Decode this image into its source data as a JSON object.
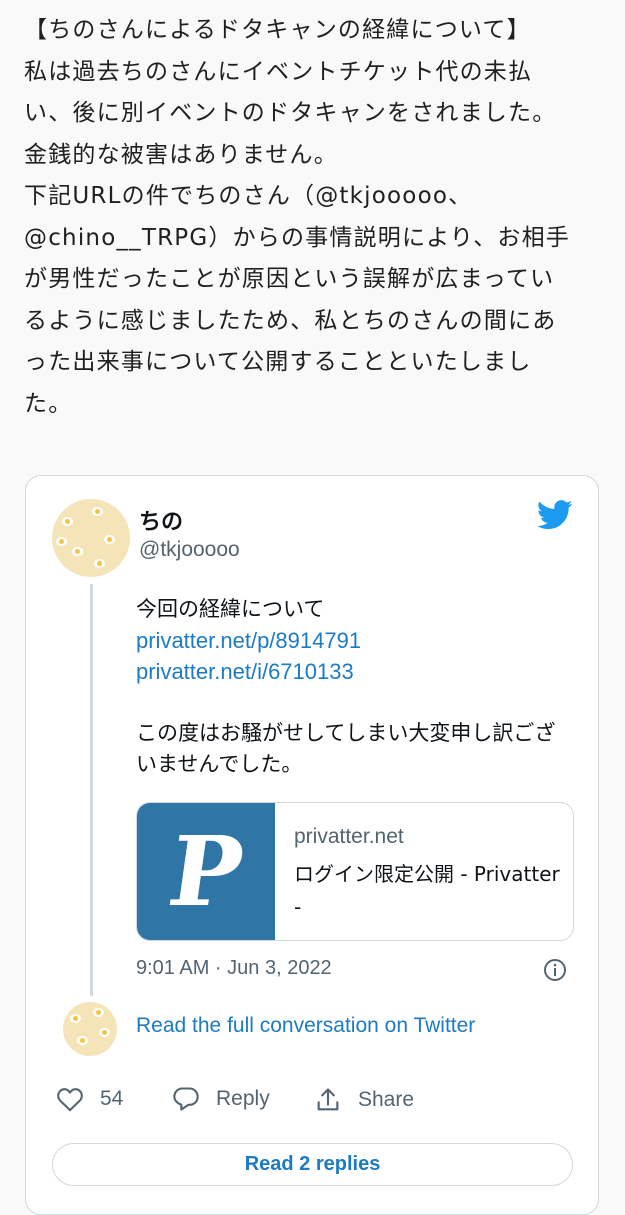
{
  "article": {
    "lines": [
      "【ちのさんによるドタキャンの経緯について】",
      "私は過去ちのさんにイベントチケット代の未払",
      "い、後に別イベントのドタキャンをされました。",
      "金銭的な被害はありません。",
      "下記URLの件でちのさん（@tkjooooo、",
      "@chino__TRPG）からの事情説明により、お相手",
      "が男性だったことが原因という誤解が広まってい",
      "るように感じましたため、私とちのさんの間にあ",
      "った出来事について公開することといたしまし",
      "た。"
    ]
  },
  "tweet": {
    "name": "ちの",
    "handle": "@tkjooooo",
    "text_line1": "今回の経緯について",
    "link1": "privatter.net/p/8914791",
    "link2": "privatter.net/i/6710133",
    "text_line2": "この度はお騒がせしてしまい大変申し訳ござ",
    "text_line3": "いませんでした。",
    "link_card": {
      "thumb_letter": "P",
      "domain": "privatter.net",
      "title": "ログイン限定公開 - Privatter -"
    },
    "timestamp": "9:01 AM · Jun 3, 2022",
    "read_full": "Read the full conversation on Twitter",
    "likes": "54",
    "reply_label": "Reply",
    "share_label": "Share",
    "read_replies": "Read 2 replies"
  },
  "colors": {
    "link": "#1d7bc4",
    "twitter_blue": "#1d9bf0",
    "thumb_bg": "#2f75a6"
  },
  "icons": [
    "twitter-bird-icon",
    "info-icon",
    "heart-icon",
    "reply-icon",
    "share-icon"
  ]
}
